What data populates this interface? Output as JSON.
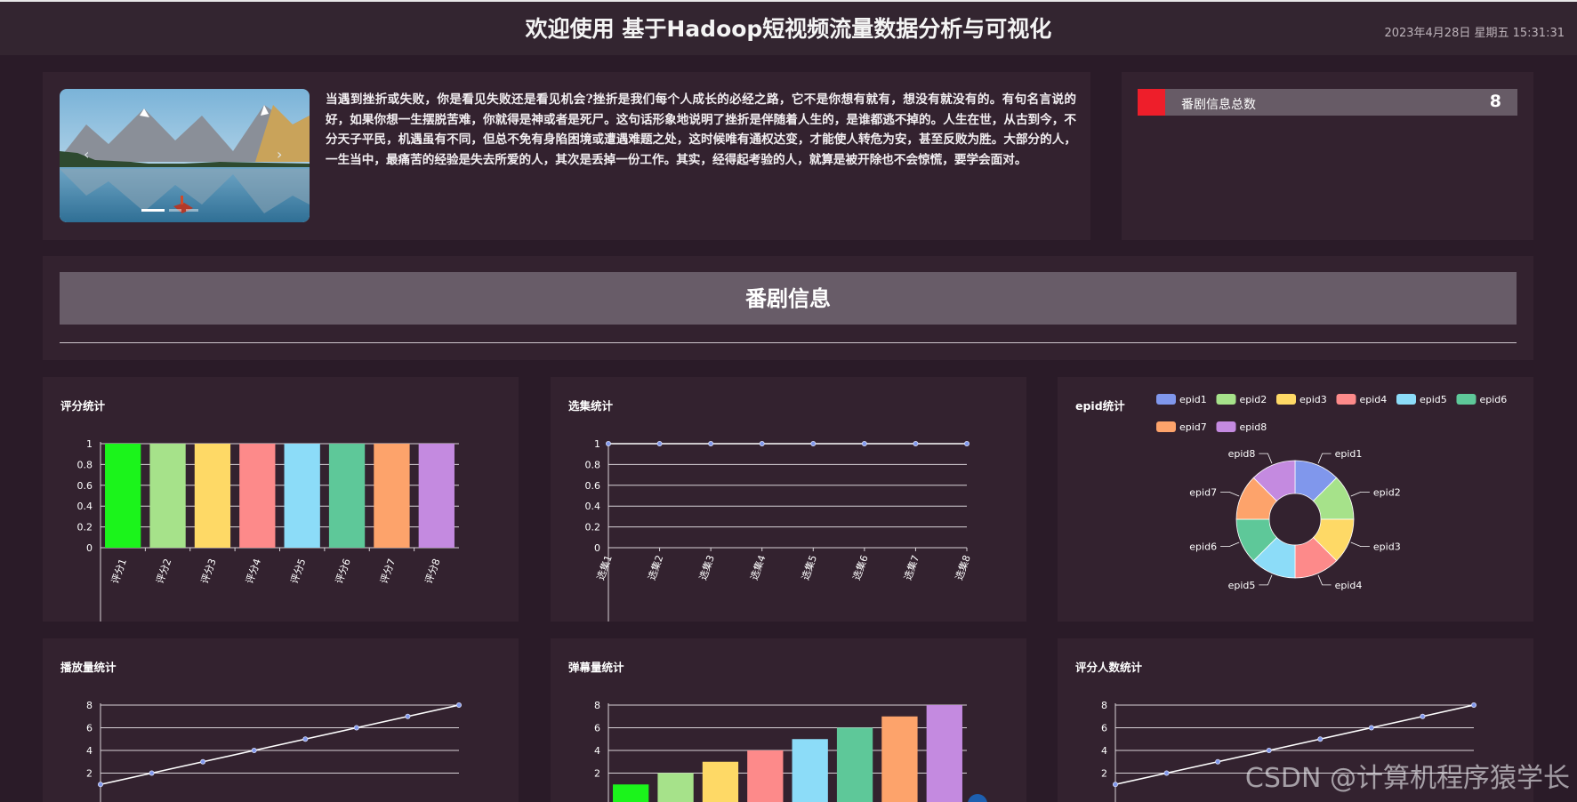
{
  "header": {
    "title": "欢迎使用 基于Hadoop短视频流量数据分析与可视化",
    "datetime": "2023年4月28日 星期五 15:31:31"
  },
  "intro": {
    "carousel_prev": "‹",
    "carousel_next": "›",
    "paragraph": "当遇到挫折或失败，你是看见失败还是看见机会?挫折是我们每个人成长的必经之路，它不是你想有就有，想没有就没有的。有句名言说的好，如果你想一生摆脱苦难，你就得是神或者是死尸。这句话形象地说明了挫折是伴随着人生的，是谁都逃不掉的。人生在世，从古到今，不分天子平民，机遇虽有不同，但总不免有身陷困境或遭遇难题之处，这时候唯有通权达变，才能使人转危为安，甚至反败为胜。大部分的人，一生当中，最痛苦的经验是失去所爱的人，其次是丢掉一份工作。其实，经得起考验的人，就算是被开除也不会惊慌，要学会面对。"
  },
  "total": {
    "label": "番剧信息总数",
    "value": "8"
  },
  "section": {
    "title": "番剧信息"
  },
  "palette": [
    "#1bf41b",
    "#a6e28a",
    "#fed966",
    "#fd8a8a",
    "#8cdcf8",
    "#5ec899",
    "#fda36b",
    "#c48ae0"
  ],
  "pie_palette": [
    "#8097ec",
    "#a6e28a",
    "#fed966",
    "#fd8a8a",
    "#8cdcf8",
    "#5ec899",
    "#fda36b",
    "#c48ae0"
  ],
  "chart_data": [
    {
      "id": "score",
      "type": "bar",
      "title": "评分统计",
      "categories": [
        "评分1",
        "评分2",
        "评分3",
        "评分4",
        "评分5",
        "评分6",
        "评分7",
        "评分8"
      ],
      "values": [
        1,
        1,
        1,
        1,
        1,
        1,
        1,
        1
      ],
      "yticks": [
        "0",
        "0.2",
        "0.4",
        "0.6",
        "0.8",
        "1"
      ],
      "ylim": [
        0,
        1
      ]
    },
    {
      "id": "episodes",
      "type": "line",
      "title": "选集统计",
      "categories": [
        "选集1",
        "选集2",
        "选集3",
        "选集4",
        "选集5",
        "选集6",
        "选集7",
        "选集8"
      ],
      "values": [
        1,
        1,
        1,
        1,
        1,
        1,
        1,
        1
      ],
      "yticks": [
        "0",
        "0.2",
        "0.4",
        "0.6",
        "0.8",
        "1"
      ],
      "ylim": [
        0,
        1
      ]
    },
    {
      "id": "epid",
      "type": "pie",
      "title": "epid统计",
      "labels": [
        "epid1",
        "epid2",
        "epid3",
        "epid4",
        "epid5",
        "epid6",
        "epid7",
        "epid8"
      ],
      "values": [
        1,
        1,
        1,
        1,
        1,
        1,
        1,
        1
      ]
    },
    {
      "id": "plays",
      "type": "line",
      "title": "播放量统计",
      "values": [
        1,
        2,
        3,
        4,
        5,
        6,
        7,
        8
      ],
      "yticks": [
        "2",
        "4",
        "6",
        "8"
      ],
      "ylim": [
        0,
        8
      ]
    },
    {
      "id": "danmaku",
      "type": "bar",
      "title": "弹幕量统计",
      "values": [
        1,
        2,
        3,
        4,
        5,
        6,
        7,
        8
      ],
      "yticks": [
        "2",
        "4",
        "6",
        "8"
      ],
      "ylim": [
        0,
        8
      ]
    },
    {
      "id": "raters",
      "type": "line",
      "title": "评分人数统计",
      "values": [
        1,
        2,
        3,
        4,
        5,
        6,
        7,
        8
      ],
      "yticks": [
        "2",
        "4",
        "6",
        "8"
      ],
      "ylim": [
        0,
        8
      ]
    }
  ],
  "watermark": "CSDN @计算机程序猿学长"
}
